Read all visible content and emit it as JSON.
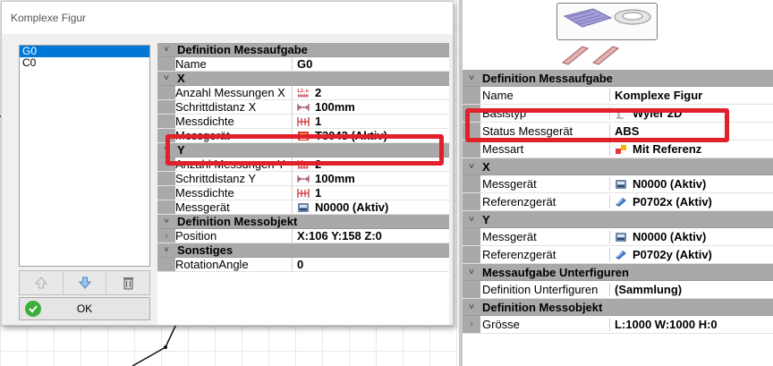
{
  "dialog": {
    "title": "Komplexe Figur",
    "figures": [
      "G0",
      "C0"
    ],
    "ok_label": "OK",
    "grid": [
      {
        "kind": "cat",
        "label": "Definition Messaufgabe"
      },
      {
        "kind": "prop",
        "name": "Name",
        "value": "G0",
        "icon": ""
      },
      {
        "kind": "cat",
        "label": "X"
      },
      {
        "kind": "prop",
        "name": "Anzahl Messungen X",
        "value": "2",
        "icon": "count-icon"
      },
      {
        "kind": "prop",
        "name": "Schrittdistanz X",
        "value": "100mm",
        "icon": "step-icon"
      },
      {
        "kind": "prop",
        "name": "Messdichte",
        "value": "1",
        "icon": "density-icon"
      },
      {
        "kind": "prop",
        "name": "Messgerät",
        "value": "T3043 (Aktiv)",
        "icon": "level-icon"
      },
      {
        "kind": "cat",
        "label": "Y"
      },
      {
        "kind": "prop",
        "name": "Anzahl Messungen Y",
        "value": "2",
        "icon": "count-icon"
      },
      {
        "kind": "prop",
        "name": "Schrittdistanz Y",
        "value": "100mm",
        "icon": "step-icon"
      },
      {
        "kind": "prop",
        "name": "Messdichte",
        "value": "1",
        "icon": "density-icon"
      },
      {
        "kind": "prop",
        "name": "Messgerät",
        "value": "N0000 (Aktiv)",
        "icon": "device-icon"
      },
      {
        "kind": "cat",
        "label": "Definition Messobjekt"
      },
      {
        "kind": "prop",
        "name": "Position",
        "value": "X:106   Y:158   Z:0",
        "icon": "",
        "expandable": true
      },
      {
        "kind": "cat",
        "label": "Sonstiges"
      },
      {
        "kind": "prop",
        "name": "RotationAngle",
        "value": "0",
        "icon": ""
      }
    ]
  },
  "right_panel": {
    "grid": [
      {
        "kind": "cat",
        "label": "Definition Messaufgabe"
      },
      {
        "kind": "prop",
        "name": "Name",
        "value": "Komplexe Figur",
        "icon": ""
      },
      {
        "kind": "prop",
        "name": "Basistyp",
        "value": "Wyler 2D",
        "icon": "basis-icon"
      },
      {
        "kind": "prop",
        "name": "Status Messgerät",
        "value": "ABS",
        "icon": ""
      },
      {
        "kind": "prop",
        "name": "Messart",
        "value": "Mit Referenz",
        "icon": "reference-icon"
      },
      {
        "kind": "cat",
        "label": "X"
      },
      {
        "kind": "prop",
        "name": "Messgerät",
        "value": "N0000 (Aktiv)",
        "icon": "device-icon"
      },
      {
        "kind": "prop",
        "name": "Referenzgerät",
        "value": "P0702x (Aktiv)",
        "icon": "sensor-icon"
      },
      {
        "kind": "cat",
        "label": "Y"
      },
      {
        "kind": "prop",
        "name": "Messgerät",
        "value": "N0000 (Aktiv)",
        "icon": "device-icon"
      },
      {
        "kind": "prop",
        "name": "Referenzgerät",
        "value": "P0702y (Aktiv)",
        "icon": "sensor-icon"
      },
      {
        "kind": "cat",
        "label": "Messaufgabe Unterfiguren"
      },
      {
        "kind": "prop",
        "name": "Definition Unterfiguren",
        "value": "(Sammlung)",
        "icon": ""
      },
      {
        "kind": "cat",
        "label": "Definition Messobjekt"
      },
      {
        "kind": "prop",
        "name": "Grösse",
        "value": "L:1000   W:1000   H:0",
        "icon": "",
        "expandable": true
      }
    ]
  },
  "colors": {
    "highlight": "#e0202b",
    "category_bg": "#a9a9a9",
    "selection": "#0078d7"
  }
}
